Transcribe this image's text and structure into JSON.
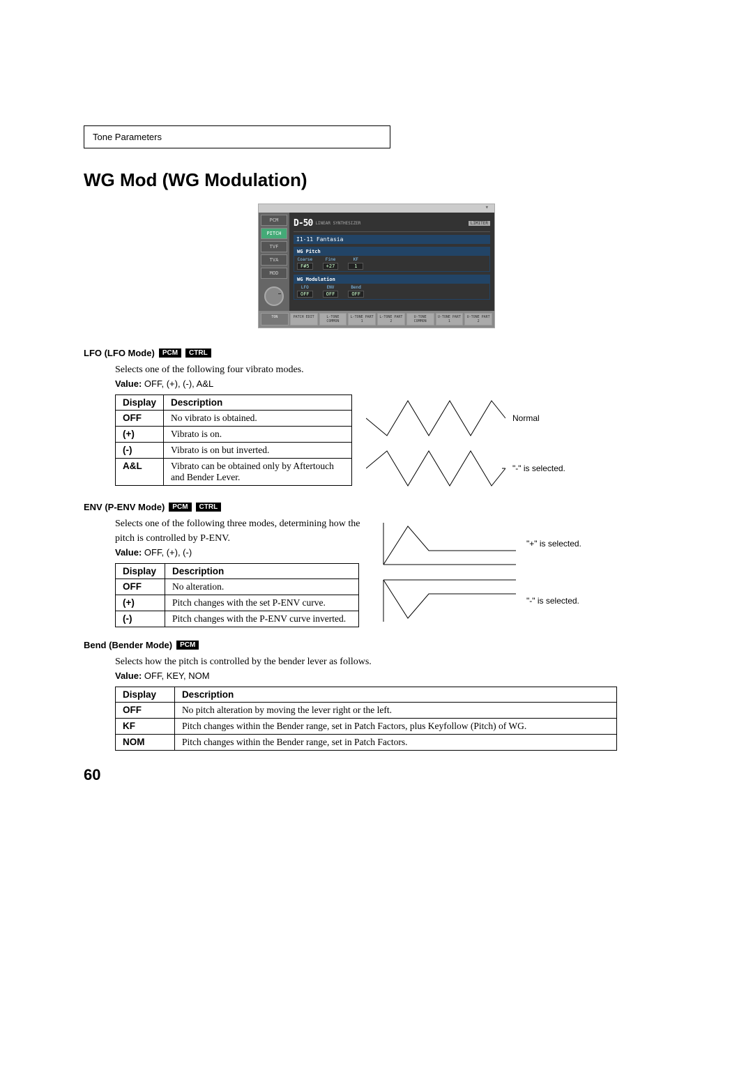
{
  "header": "Tone Parameters",
  "title": "WG Mod (WG Modulation)",
  "screenshot": {
    "logo_big": "D-50",
    "logo_sub": "LINEAR\nSYNTHESIZER",
    "patch_label": "I1-11 Fantasia",
    "side_tabs": [
      "PCM",
      "PITCH",
      "TVF",
      "TVA",
      "MOD"
    ],
    "wg_pitch_hdr": "WG Pitch",
    "wg_pitch": [
      {
        "label": "Coarse",
        "value": "F#5"
      },
      {
        "label": "Fine",
        "value": "+27"
      },
      {
        "label": "KF",
        "value": "1"
      }
    ],
    "wg_mod_hdr": "WG Modulation",
    "wg_mod": [
      {
        "label": "LFO",
        "value": "OFF"
      },
      {
        "label": "ENV",
        "value": "OFF"
      },
      {
        "label": "Bend",
        "value": "OFF"
      }
    ],
    "bottom_tabs": [
      "TON",
      "PATCH EDIT",
      "L-TONE COMMON",
      "L-TONE PART 1",
      "L-TONE PART 2",
      "U-TONE COMMON",
      "U-TONE PART 1",
      "U-TONE PART 2"
    ],
    "limiter": "LIMITER"
  },
  "lfo": {
    "heading": "LFO (LFO Mode)",
    "badge1": "PCM",
    "badge2": "CTRL",
    "desc": "Selects one of the following four vibrato modes.",
    "value_label": "Value:",
    "value": "OFF, (+), (-), A&L",
    "col_display": "Display",
    "col_desc": "Description",
    "rows": [
      {
        "k": "OFF",
        "v": "No vibrato is obtained."
      },
      {
        "k": "(+)",
        "v": "Vibrato is on."
      },
      {
        "k": "(-)",
        "v": "Vibrato is on but inverted."
      },
      {
        "k": "A&L",
        "v": "Vibrato can be obtained only by Aftertouch and Bender Lever."
      }
    ],
    "wave_normal": "Normal",
    "wave_minus": "\"-\" is selected."
  },
  "env": {
    "heading": "ENV (P-ENV Mode)",
    "badge1": "PCM",
    "badge2": "CTRL",
    "desc": "Selects one of the following three modes, determining how the pitch is controlled by P-ENV.",
    "value_label": "Value:",
    "value": "OFF, (+), (-)",
    "col_display": "Display",
    "col_desc": "Description",
    "rows": [
      {
        "k": "OFF",
        "v": "No alteration."
      },
      {
        "k": "(+)",
        "v": "Pitch changes with the set P-ENV curve."
      },
      {
        "k": "(-)",
        "v": "Pitch changes with the P-ENV curve inverted."
      }
    ],
    "wave_plus": "\"+\" is selected.",
    "wave_minus": "\"-\" is selected."
  },
  "bend": {
    "heading": "Bend (Bender Mode)",
    "badge1": "PCM",
    "desc": "Selects how the pitch is controlled by the bender lever as follows.",
    "value_label": "Value:",
    "value": "OFF, KEY, NOM",
    "col_display": "Display",
    "col_desc": "Description",
    "rows": [
      {
        "k": "OFF",
        "v": "No pitch alteration by moving the lever right or the left."
      },
      {
        "k": "KF",
        "v": "Pitch changes within the Bender range, set in Patch Factors, plus Keyfollow (Pitch) of WG."
      },
      {
        "k": "NOM",
        "v": "Pitch changes within the Bender range, set in Patch Factors."
      }
    ]
  },
  "page_number": "60"
}
